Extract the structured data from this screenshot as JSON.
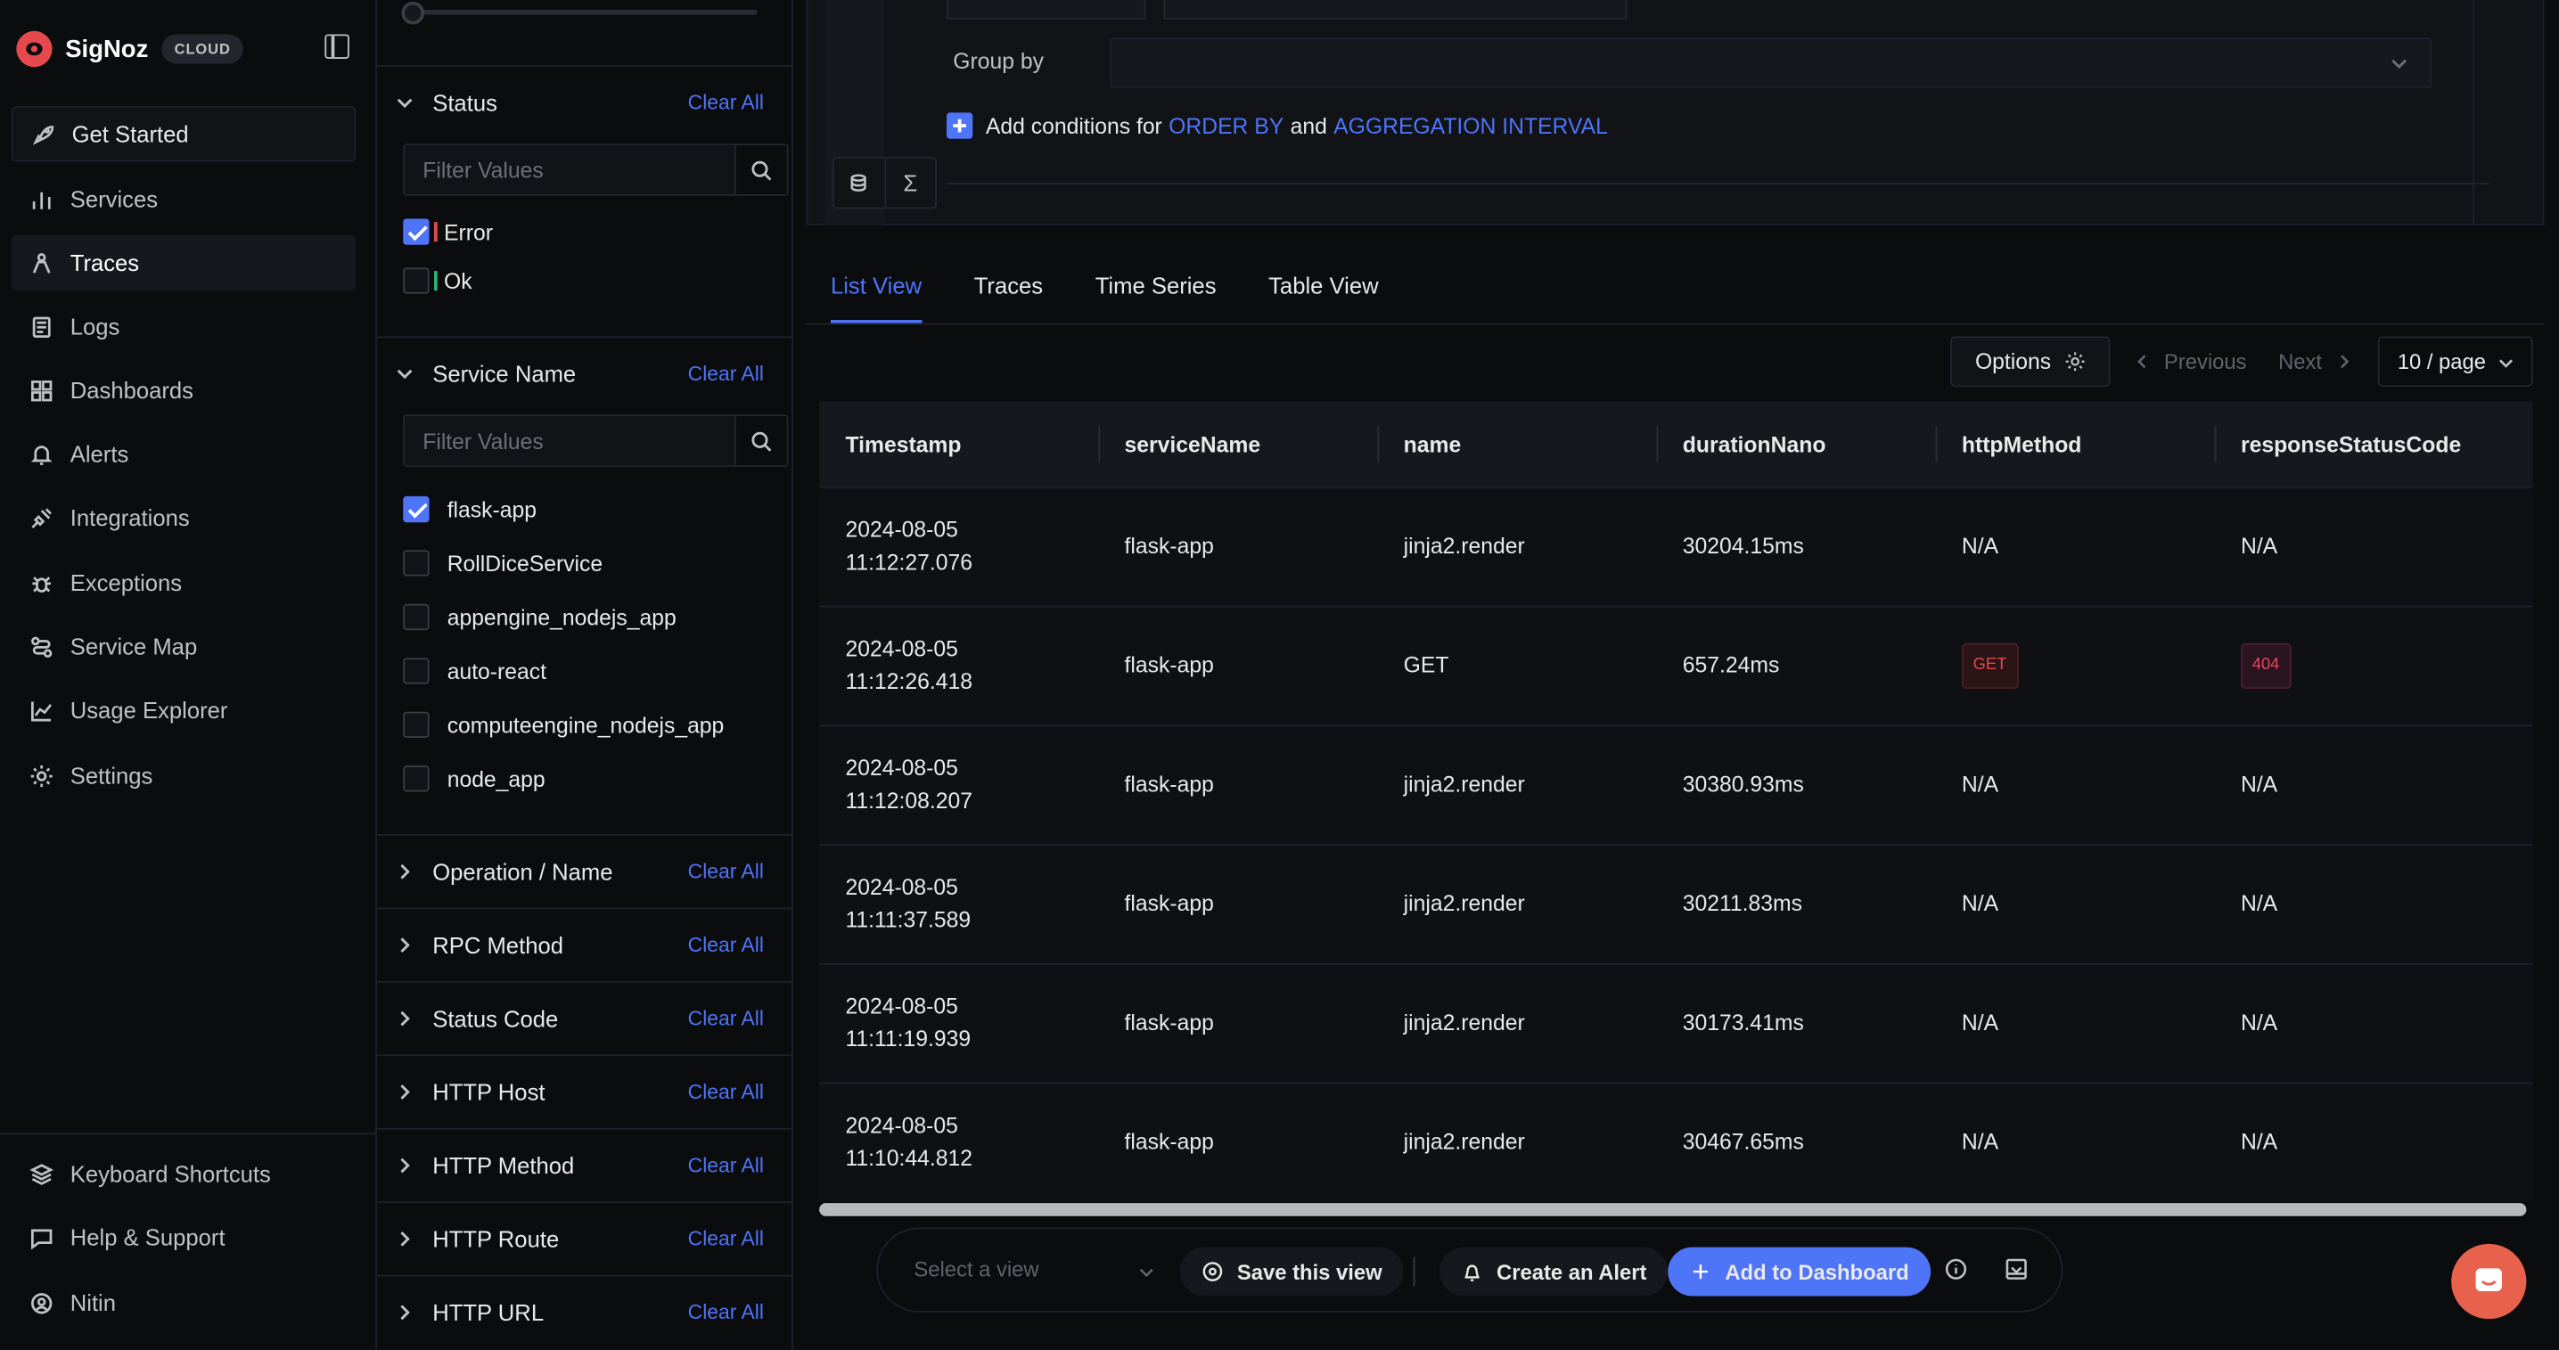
{
  "app": {
    "name": "SigNoz",
    "badge": "CLOUD"
  },
  "sidebar": {
    "items": [
      {
        "label": "Get Started",
        "icon": "rocket-icon"
      },
      {
        "label": "Services",
        "icon": "bar-chart-icon"
      },
      {
        "label": "Traces",
        "icon": "traces-icon"
      },
      {
        "label": "Logs",
        "icon": "logs-icon"
      },
      {
        "label": "Dashboards",
        "icon": "dashboard-grid-icon"
      },
      {
        "label": "Alerts",
        "icon": "bell-icon"
      },
      {
        "label": "Integrations",
        "icon": "plug-icon"
      },
      {
        "label": "Exceptions",
        "icon": "bug-icon"
      },
      {
        "label": "Service Map",
        "icon": "route-icon"
      },
      {
        "label": "Usage Explorer",
        "icon": "line-chart-icon"
      },
      {
        "label": "Settings",
        "icon": "gear-icon"
      }
    ],
    "footer": [
      {
        "label": "Keyboard Shortcuts",
        "icon": "layers-icon"
      },
      {
        "label": "Help & Support",
        "icon": "message-icon"
      },
      {
        "label": "Nitin",
        "icon": "user-icon"
      }
    ]
  },
  "filters": {
    "clear_label": "Clear All",
    "placeholder": "Filter Values",
    "status": {
      "title": "Status",
      "options": [
        {
          "label": "Error",
          "checked": true,
          "color": "#e5484d"
        },
        {
          "label": "Ok",
          "checked": false,
          "color": "#2bb673"
        }
      ]
    },
    "service_name": {
      "title": "Service Name",
      "options": [
        {
          "label": "flask-app",
          "checked": true
        },
        {
          "label": "RollDiceService",
          "checked": false
        },
        {
          "label": "appengine_nodejs_app",
          "checked": false
        },
        {
          "label": "auto-react",
          "checked": false
        },
        {
          "label": "computeengine_nodejs_app",
          "checked": false
        },
        {
          "label": "node_app",
          "checked": false
        }
      ]
    },
    "collapsed": [
      "Operation / Name",
      "RPC Method",
      "Status Code",
      "HTTP Host",
      "HTTP Method",
      "HTTP Route",
      "HTTP URL"
    ]
  },
  "query": {
    "group_by_label": "Group by",
    "add_conditions": {
      "prefix": "Add conditions for",
      "kw1": "ORDER BY",
      "and": "and",
      "kw2": "AGGREGATION INTERVAL"
    },
    "sigma": "Σ"
  },
  "tabs": [
    "List View",
    "Traces",
    "Time Series",
    "Table View"
  ],
  "toolbar": {
    "options": "Options",
    "previous": "Previous",
    "next": "Next",
    "page_size": "10 / page"
  },
  "table": {
    "columns": [
      "Timestamp",
      "serviceName",
      "name",
      "durationNano",
      "httpMethod",
      "responseStatusCode"
    ],
    "rows": [
      {
        "date": "2024-08-05",
        "time": "11:12:27.076",
        "service": "flask-app",
        "name": "jinja2.render",
        "duration": "30204.15ms",
        "method": "N/A",
        "status": "N/A"
      },
      {
        "date": "2024-08-05",
        "time": "11:12:26.418",
        "service": "flask-app",
        "name": "GET",
        "duration": "657.24ms",
        "method": "GET",
        "status": "404"
      },
      {
        "date": "2024-08-05",
        "time": "11:12:08.207",
        "service": "flask-app",
        "name": "jinja2.render",
        "duration": "30380.93ms",
        "method": "N/A",
        "status": "N/A"
      },
      {
        "date": "2024-08-05",
        "time": "11:11:37.589",
        "service": "flask-app",
        "name": "jinja2.render",
        "duration": "30211.83ms",
        "method": "N/A",
        "status": "N/A"
      },
      {
        "date": "2024-08-05",
        "time": "11:11:19.939",
        "service": "flask-app",
        "name": "jinja2.render",
        "duration": "30173.41ms",
        "method": "N/A",
        "status": "N/A"
      },
      {
        "date": "2024-08-05",
        "time": "11:10:44.812",
        "service": "flask-app",
        "name": "jinja2.render",
        "duration": "30467.65ms",
        "method": "N/A",
        "status": "N/A"
      }
    ]
  },
  "bottom_bar": {
    "view_placeholder": "Select a view",
    "save_view": "Save this view",
    "create_alert": "Create an Alert",
    "add_dashboard": "Add to Dashboard"
  },
  "colors": {
    "accent": "#4e74f8",
    "error": "#e5484d",
    "ok": "#2bb673",
    "chat": "#e8614c"
  }
}
